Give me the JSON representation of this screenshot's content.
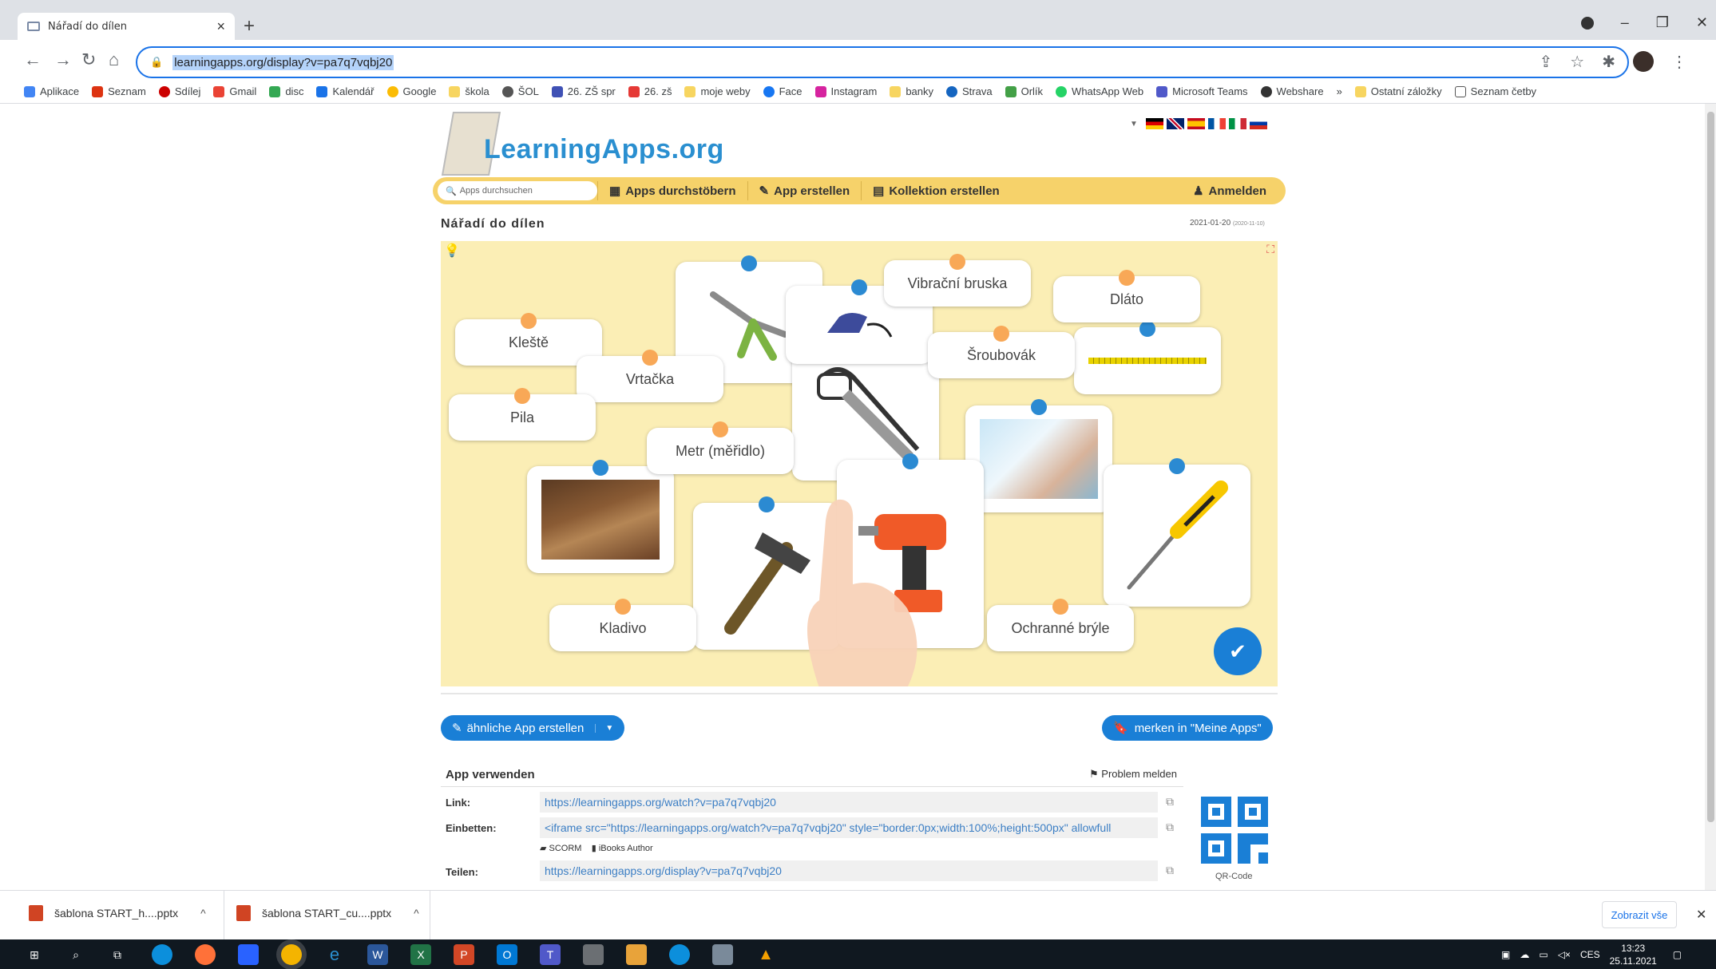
{
  "browser": {
    "tab_title": "Nářadí do dílen",
    "url": "learningapps.org/display?v=pa7q7vqbj20",
    "bookmarks": [
      "Aplikace",
      "Seznam",
      "Sdílej",
      "Gmail",
      "disc",
      "Kalendář",
      "Google",
      "škola",
      "ŠOL",
      "26. ZŠ spr",
      "26. zš",
      "moje weby",
      "Face",
      "Instagram",
      "banky",
      "Strava",
      "Orlík",
      "WhatsApp Web",
      "Microsoft Teams",
      "Webshare",
      "»",
      "Ostatní záložky",
      "Seznam četby"
    ]
  },
  "site": {
    "logo": "LearningApps.org",
    "search_placeholder": "Apps durchsuchen",
    "menu": [
      "Apps durchstöbern",
      "App erstellen",
      "Kollektion erstellen"
    ],
    "login": "Anmelden",
    "app_title": "Nářadí do dílen",
    "date": "2021-01-20",
    "date_small": "(2020-11-10)"
  },
  "board": {
    "labels": {
      "klieste": "Kleště",
      "vrtacka": "Vrtačka",
      "pila": "Pila",
      "metr": "Metr (měřidlo)",
      "vibracni": "Vibrační bruska",
      "dlato": "Dláto",
      "sroubovak": "Šroubovák",
      "kladivo": "Kladivo",
      "bryle": "Ochranné brýle"
    }
  },
  "actions": {
    "similar": "ähnliche App erstellen",
    "save": "merken in \"Meine Apps\""
  },
  "use": {
    "title": "App verwenden",
    "report": "Problem melden",
    "link_label": "Link:",
    "link_value": "https://learningapps.org/watch?v=pa7q7vqbj20",
    "embed_label": "Einbetten:",
    "embed_value": "<iframe src=\"https://learningapps.org/watch?v=pa7q7vqbj20\" style=\"border:0px;width:100%;height:500px\" allowfull",
    "scorm": "SCORM",
    "ibooks": "iBooks Author",
    "share_label": "Teilen:",
    "share_value": "https://learningapps.org/display?v=pa7q7vqbj20",
    "qr_label": "QR-Code"
  },
  "downloads": {
    "items": [
      "šablona START_h....pptx",
      "šablona START_cu....pptx"
    ],
    "show_all": "Zobrazit vše"
  },
  "taskbar": {
    "lang": "CES",
    "time": "13:23",
    "date": "25.11.2021"
  }
}
